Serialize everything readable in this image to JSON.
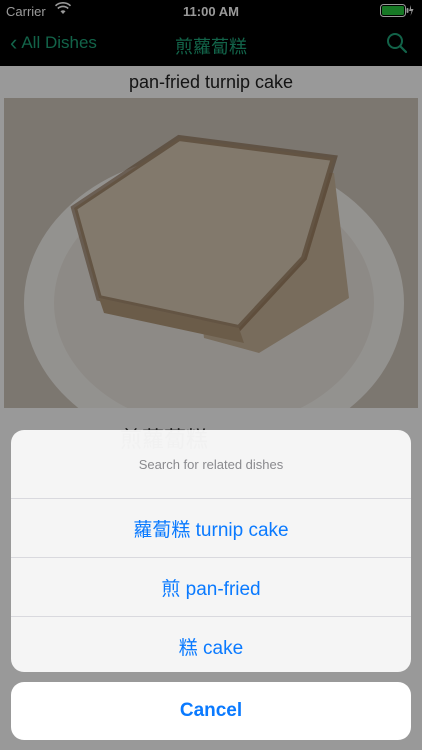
{
  "status_bar": {
    "carrier": "Carrier",
    "time": "11:00 AM"
  },
  "navbar": {
    "back_label": "All Dishes",
    "title": "煎蘿蔔糕",
    "search_icon": "search-icon"
  },
  "dish": {
    "title": "pan-fried turnip cake",
    "subtitle": "煎蘿蔔糕"
  },
  "action_sheet": {
    "header": "Search for related dishes",
    "options": [
      "蘿蔔糕 turnip cake",
      "煎 pan-fried",
      "糕 cake"
    ],
    "cancel_label": "Cancel"
  },
  "colors": {
    "accent_green": "#1fa67a",
    "ios_blue": "#0a7aff"
  }
}
